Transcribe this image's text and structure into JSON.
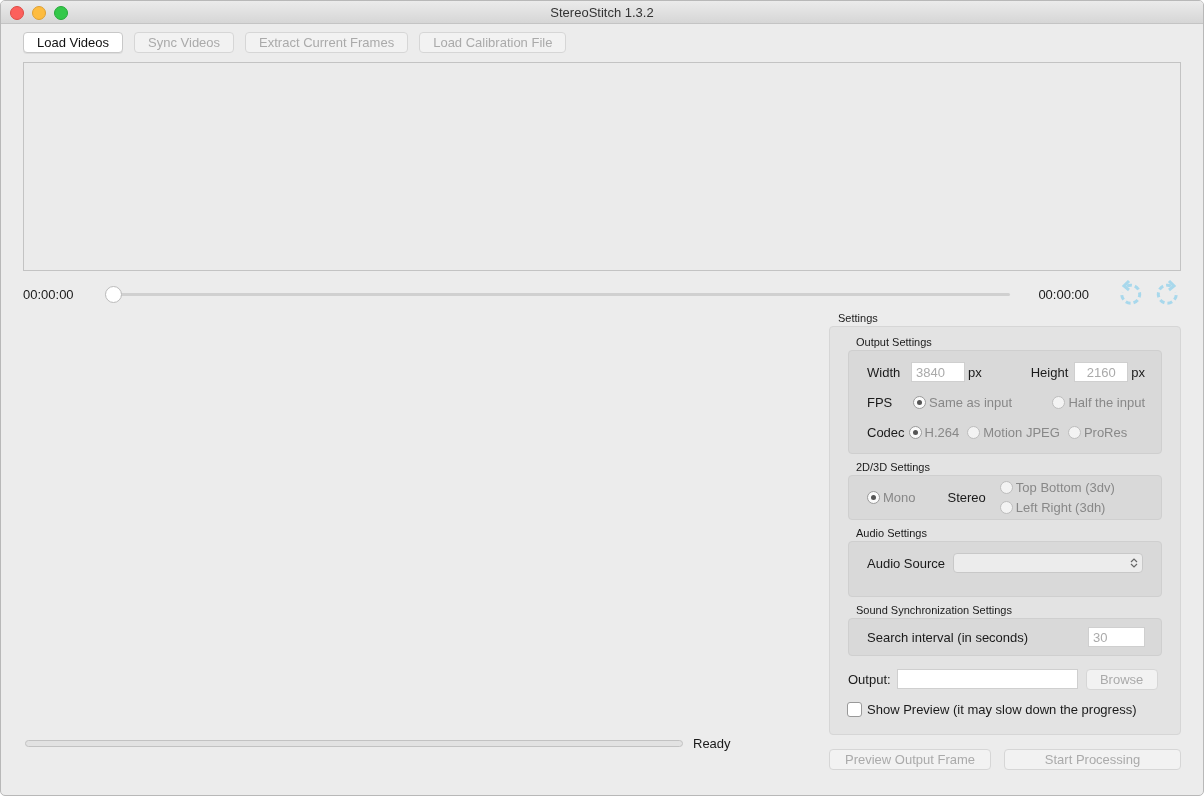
{
  "window": {
    "title": "StereoStitch 1.3.2"
  },
  "toolbar": [
    {
      "label": "Load Videos",
      "disabled": false
    },
    {
      "label": "Sync Videos",
      "disabled": true
    },
    {
      "label": "Extract Current Frames",
      "disabled": true
    },
    {
      "label": "Load Calibration File",
      "disabled": true
    }
  ],
  "timeline": {
    "start_time": "00:00:00",
    "end_time": "00:00:00",
    "level": 0
  },
  "settings": {
    "title": "Settings",
    "output": {
      "title": "Output Settings",
      "width_label": "Width",
      "width_value": "3840",
      "width_unit": "px",
      "height_label": "Height",
      "height_value": "2160",
      "height_unit": "px",
      "fps_label": "FPS",
      "fps_options": [
        {
          "label": "Same as input",
          "selected": true
        },
        {
          "label": "Half the input",
          "selected": false
        }
      ],
      "codec_label": "Codec",
      "codec_options": [
        {
          "label": "H.264",
          "selected": true
        },
        {
          "label": "Motion JPEG",
          "selected": false
        },
        {
          "label": "ProRes",
          "selected": false
        }
      ]
    },
    "mode": {
      "title": "2D/3D Settings",
      "mono": {
        "label": "Mono",
        "selected": true
      },
      "stereo_label": "Stereo",
      "stereo_options": [
        {
          "label": "Top Bottom (3dv)",
          "selected": false
        },
        {
          "label": "Left Right   (3dh)",
          "selected": false
        }
      ]
    },
    "audio": {
      "title": "Audio Settings",
      "source_label": "Audio Source"
    },
    "sync": {
      "title": "Sound Synchronization Settings",
      "interval_label": "Search interval (in seconds)",
      "interval_value": "30"
    },
    "output_label": "Output:",
    "browse": {
      "label": "Browse",
      "disabled": true
    },
    "preview": {
      "label": "Show Preview (it may slow down the progress)",
      "checked": false
    }
  },
  "progress": {
    "level": 0,
    "status": "Ready"
  },
  "actions": [
    {
      "label": "Preview Output Frame",
      "disabled": true
    },
    {
      "label": "Start Processing",
      "disabled": true
    }
  ]
}
